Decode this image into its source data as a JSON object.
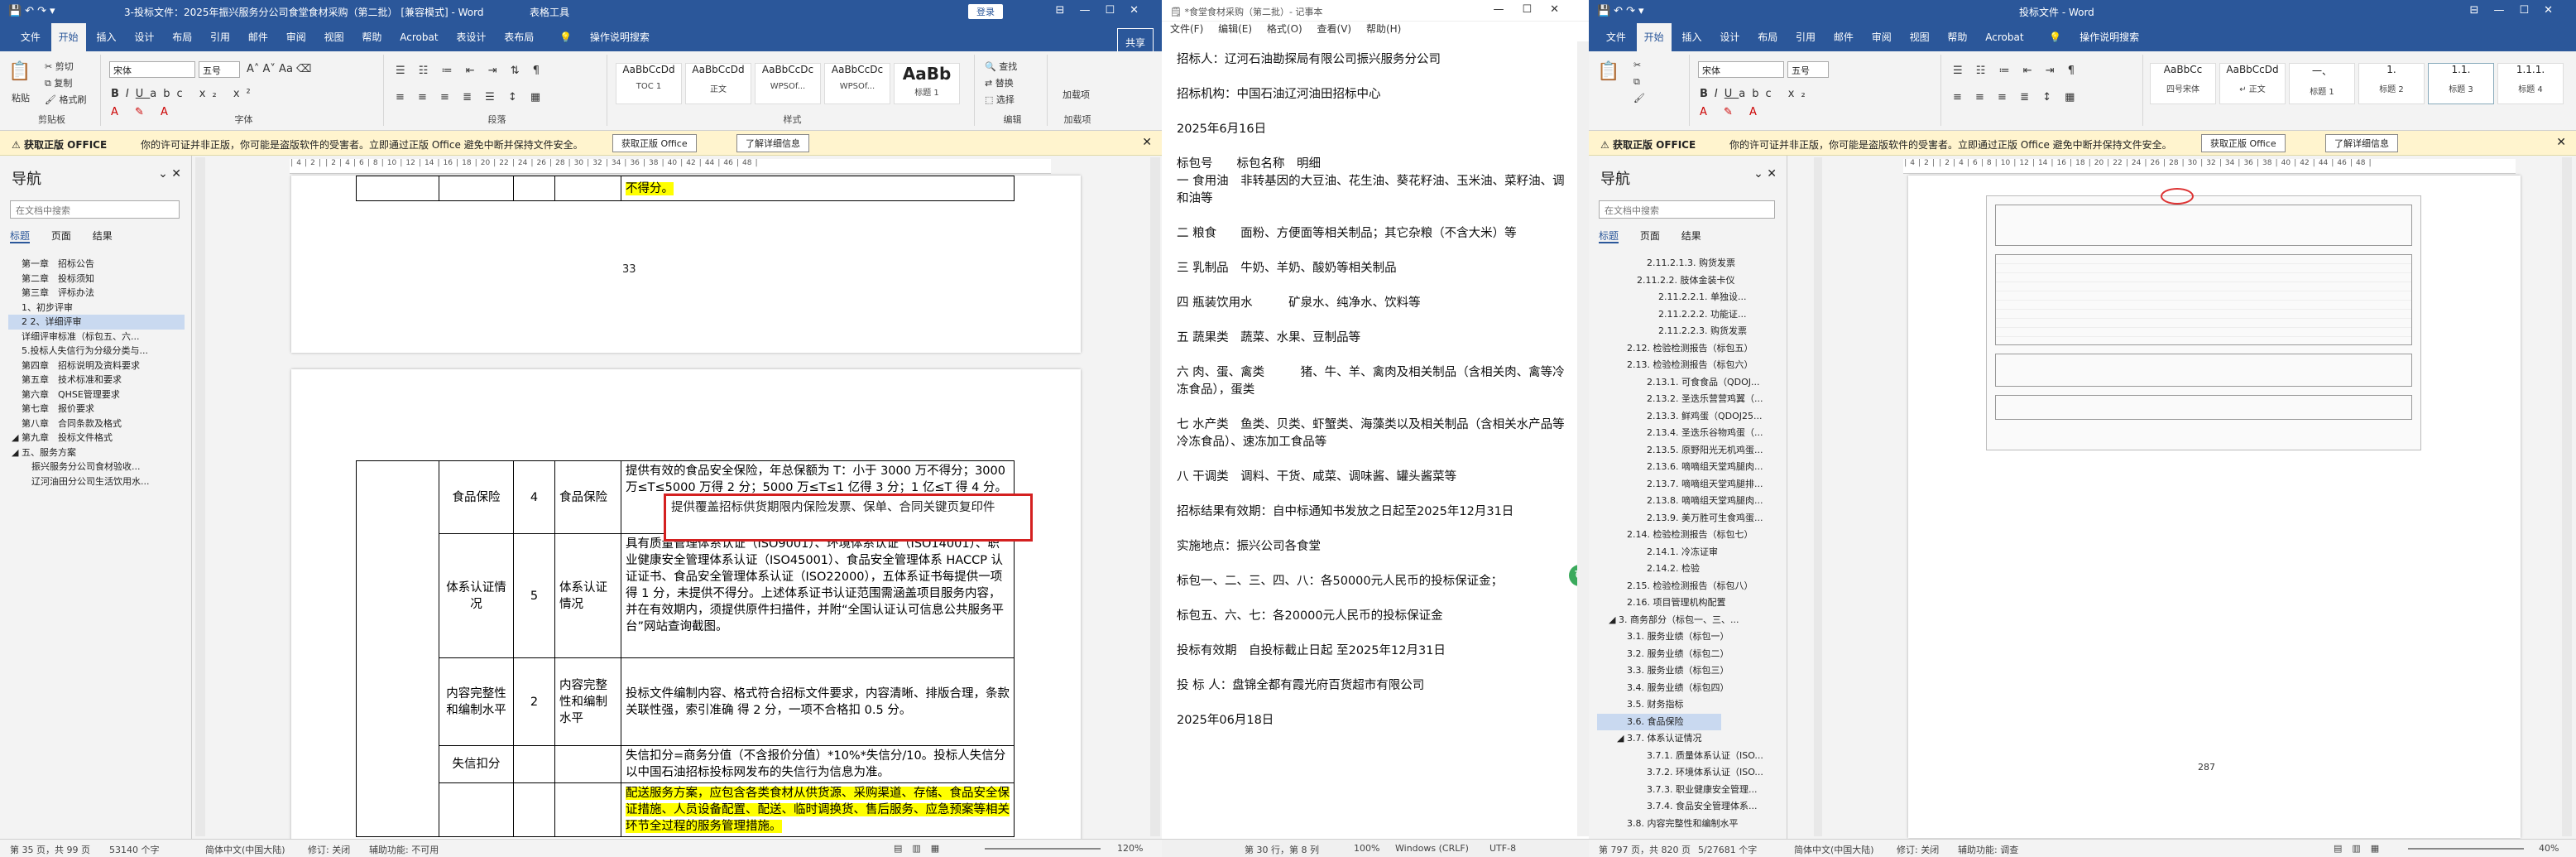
{
  "w1": {
    "title": "3-投标文件：2025年振兴服务分公司食堂食材采购（第二批） [兼容模式] - Word",
    "table_tools": "表格工具",
    "login": "登录",
    "tabs": [
      "文件",
      "开始",
      "插入",
      "设计",
      "布局",
      "引用",
      "邮件",
      "审阅",
      "视图",
      "帮助",
      "Acrobat",
      "表设计",
      "表布局",
      "操作说明搜索"
    ],
    "share": "共享",
    "clipboard": {
      "paste": "粘贴",
      "cut": "剪切",
      "copy": "复制",
      "painter": "格式刷",
      "name": "剪贴板"
    },
    "font": {
      "family": "宋体",
      "size": "五号",
      "name": "字体"
    },
    "paragraph_name": "段落",
    "styles": [
      {
        "sample": "AaBbCcDd",
        "name": "TOC 1"
      },
      {
        "sample": "AaBbCcDd",
        "name": "正文"
      },
      {
        "sample": "AaBbCcDc",
        "name": "WPSOf..."
      },
      {
        "sample": "AaBbCcDc",
        "name": "WPSOf..."
      },
      {
        "sample": "AaBb",
        "name": "标题 1"
      }
    ],
    "styles_name": "样式",
    "editing": {
      "find": "查找",
      "replace": "替换",
      "select": "选择",
      "name": "编辑"
    },
    "addin": {
      "label": "加载项",
      "name": "加载项"
    },
    "warning": {
      "label": "获取正版 OFFICE",
      "msg": "你的许可证并非正版，你可能是盗版软件的受害者。立即通过正版 Office 避免中断并保持文件安全。",
      "btn1": "获取正版 Office",
      "btn2": "了解详细信息"
    },
    "nav": {
      "title": "导航",
      "search": "在文档中搜索",
      "tabs": [
        "标题",
        "页面",
        "结果"
      ],
      "items": [
        "第一章　招标公告",
        "第二章　投标须知",
        "第三章　评标办法",
        "1、初步评审",
        "2 2、详细评审",
        "详细评审标准（标包五、六...",
        "5.投标人失信行为分级分类与...",
        "第四章　招标说明及资料要求",
        "第五章　技术标准和要求",
        "第六章　QHSE管理要求",
        "第七章　报价要求",
        "第八章　合同条款及格式",
        "第九章　投标文件格式",
        "",
        "五、服务方案",
        "振兴服务分公司食材验收...",
        "辽河油田分公司生活饮用水..."
      ]
    },
    "page_num": "33",
    "table": {
      "r0": "不得分。",
      "food_cat": "食品保险",
      "food_score": "4",
      "food_name": "食品保险",
      "food_desc": "提供有效的食品安全保险，年总保额为 T：小于 3000 万不得分；3000 万≤T≤5000 万得 2 分；5000 万≤T≤1 亿得 3 分；1 亿≤T 得 4 分。",
      "redbox": "提供覆盖招标供货期限内保险发票、保单、合同关键页复印件",
      "sys_cat": "体系认证情况",
      "sys_score": "5",
      "sys_name": "体系认证情况",
      "sys_desc": "具有质量管理体系认证（ISO9001）、环境体系认证（ISO14001）、职业健康安全管理体系认证（ISO45001）、食品安全管理体系 HACCP 认证证书、食品安全管理体系认证（ISO22000），五体系证书每提供一项得 1 分，未提供不得分。上述体系证书认证范围需涵盖项目服务内容，并在有效期内，须提供原件扫描件，并附“全国认证认可信息公共服务平台”网站查询截图。",
      "qual_cat": "内容完整性和编制水平",
      "qual_score": "2",
      "qual_name": "内容完整性和编制水平",
      "qual_desc": "投标文件编制内容、格式符合招标文件要求，内容清晰、排版合理，条款关联性强，索引准确 得 2 分，一项不合格扣 0.5 分。",
      "credit_cat": "失信扣分",
      "credit_desc": "失信扣分=商务分值（不含报价分值）*10%*失信分/10。投标人失信分以中国石油招标投标网发布的失信行为信息为准。",
      "service_desc": "配送服务方案，应包含各类食材从供货源、采购渠道、存储、食品安全保证措施、人员设备配置、配送、临时调换货、售后服务、应急预案等相关环节全过程的服务管理措施。"
    },
    "status": {
      "page": "第 35 页，共 99 页",
      "words": "53140 个字",
      "lang": "简体中文(中国大陆)",
      "track": "修订: 关闭",
      "access": "辅助功能: 不可用",
      "zoom": "120%"
    }
  },
  "w2": {
    "title": "*食堂食材采购（第二批）- 记事本",
    "menu": [
      "文件(F)",
      "编辑(E)",
      "格式(O)",
      "查看(V)",
      "帮助(H)"
    ],
    "lines": [
      "招标人：辽河石油勘探局有限公司振兴服务分公司",
      "招标机构：中国石油辽河油田招标中心",
      "2025年6月16日",
      "标包号　　标包名称　明细\n一 食用油　非转基因的大豆油、花生油、葵花籽油、玉米油、菜籽油、调和油等",
      "二 粮食　　面粉、方便面等相关制品；其它杂粮（不含大米）等",
      "三 乳制品　牛奶、羊奶、酸奶等相关制品",
      "四 瓶装饮用水　　　矿泉水、纯净水、饮料等",
      "五 蔬果类　蔬菜、水果、豆制品等",
      "六 肉、蛋、禽类　　　猪、牛、羊、禽肉及相关制品（含相关肉、禽等冷冻食品），蛋类",
      "七 水产类　鱼类、贝类、虾蟹类、海藻类以及相关制品（含相关水产品等冷冻食品）、速冻加工食品等",
      "八 干调类　调料、干货、咸菜、调味酱、罐头酱菜等",
      "招标结果有效期：自中标通知书发放之日起至2025年12月31日",
      "实施地点：振兴公司各食堂",
      "标包一、二、三、四、八：各50000元人民币的投标保证金；",
      "标包五、六、七：各20000元人民币的投标保证金",
      "投标有效期　自投标截止日起 至2025年12月31日",
      "投 标 人：盘锦全都有霞光府百货超市有限公司",
      "2025年06月18日"
    ],
    "status": {
      "pos": "第 30 行，第 8 列",
      "zoom": "100%",
      "eol": "Windows (CRLF)",
      "enc": "UTF-8"
    }
  },
  "w3": {
    "title": "投标文件 - Word",
    "tabs": [
      "文件",
      "开始",
      "插入",
      "设计",
      "布局",
      "引用",
      "邮件",
      "审阅",
      "视图",
      "帮助",
      "Acrobat",
      "操作说明搜索"
    ],
    "font": {
      "family": "宋体",
      "size": "五号"
    },
    "styles": [
      {
        "sample": "AaBbCc",
        "name": "四号宋体"
      },
      {
        "sample": "AaBbCcDd",
        "name": "↵ 正文"
      },
      {
        "sample": "一、",
        "name": "标题 1"
      },
      {
        "sample": "1.",
        "name": "标题 2"
      },
      {
        "sample": "1.1.",
        "name": "标题 3"
      },
      {
        "sample": "1.1.1.",
        "name": "标题 4"
      }
    ],
    "warning": {
      "label": "获取正版 OFFICE",
      "msg": "你的许可证并非正版，你可能是盗版软件的受害者。立即通过正版 Office 避免中断并保持文件安全。",
      "btn1": "获取正版 Office",
      "btn2": "了解详细信息"
    },
    "nav": {
      "title": "导航",
      "search": "在文档中搜索",
      "tabs": [
        "标题",
        "页面",
        "结果"
      ],
      "items": [
        "2.11.2.1.3. 购货发票",
        "2.11.2.2. 肢体金装卡仪",
        "2.11.2.2.1. 单独设...",
        "2.11.2.2.2. 功能证...",
        "2.11.2.2.3. 购货发票",
        "2.12. 检验检测报告（标包五）",
        "2.13. 检验检测报告（标包六）",
        "2.13.1. 可食食品（QDOJ...",
        "2.13.2. 圣迭乐营营鸡翼（...",
        "2.13.3. 鲜鸡蛋（QDOJ25...",
        "2.13.4. 圣迭乐谷物鸡蛋（...",
        "2.13.5. 原野阳光无机鸡蛋...",
        "2.13.6. 嘀嘀组天堂鸡腿肉...",
        "2.13.7. 嘀嘀组天堂鸡腿排...",
        "2.13.8. 嘀嘀组天堂鸡腿肉...",
        "2.13.9. 美万胜可生食鸡蛋...",
        "2.14. 检验检测报告（标包七）",
        "2.14.1. 冷冻证审",
        "2.14.2. 检验",
        "2.15. 检验检测报告（标包八）",
        "2.16. 项目管理机构配置",
        "3. 商务部分（标包一、三、...",
        "3.1. 服务业绩（标包一）",
        "3.2. 服务业绩（标包二）",
        "3.3. 服务业绩（标包三）",
        "3.4. 服务业绩（标包四）",
        "3.5. 财务指标",
        "3.6. 食品保险",
        "3.7. 体系认证情况",
        "3.7.1. 质量体系认证（ISO...",
        "3.7.2. 环境体系认证（ISO...",
        "3.7.3. 职业健康安全管理...",
        "3.7.4. 食品安全管理体系...",
        "3.8. 内容完整性和编制水平"
      ]
    },
    "page_num": "287",
    "status": {
      "page": "第 797 页，共 820 页",
      "words": "5/27681 个字",
      "lang": "简体中文(中国大陆)",
      "track": "修订: 关闭",
      "access": "辅助功能: 调查",
      "zoom": "40%"
    }
  }
}
